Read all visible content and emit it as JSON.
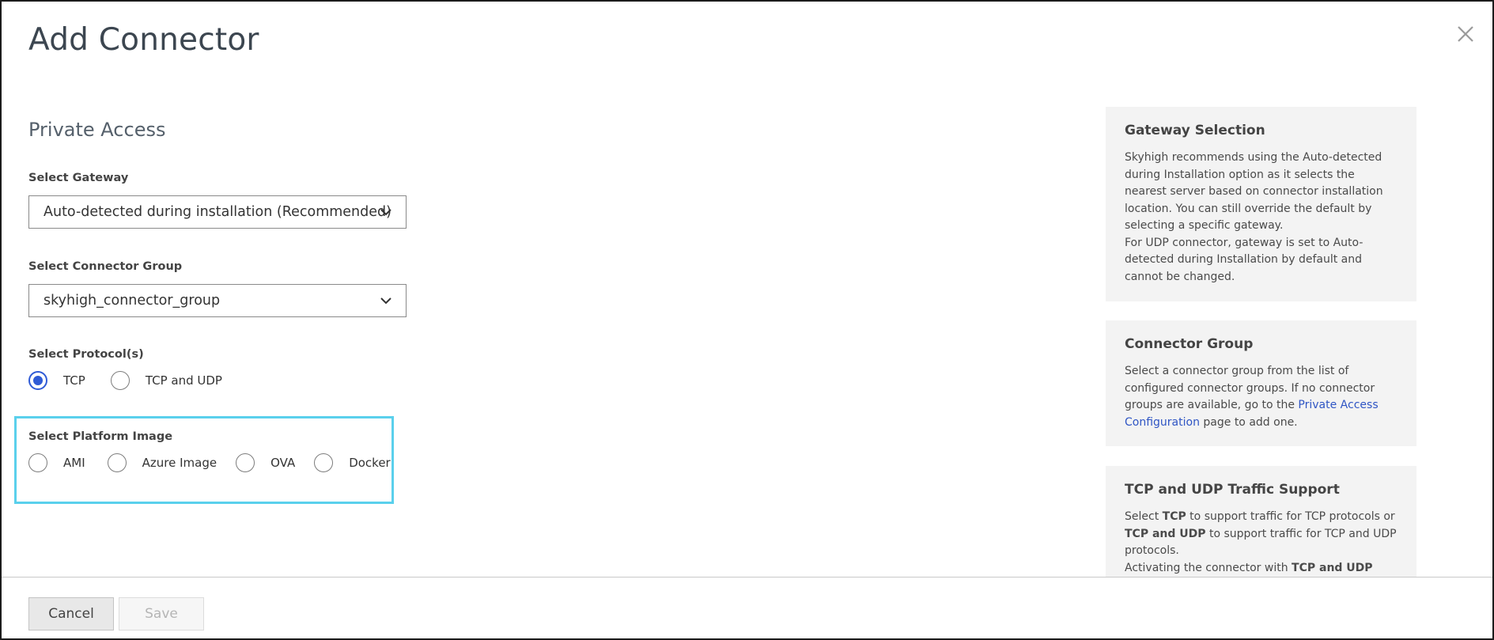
{
  "dialog": {
    "title": "Add Connector",
    "close_icon": "close-icon"
  },
  "form": {
    "section_title": "Private Access",
    "gateway": {
      "label": "Select Gateway",
      "value": "Auto-detected during installation (Recommended)"
    },
    "connector_group": {
      "label": "Select Connector Group",
      "value": "skyhigh_connector_group"
    },
    "protocols": {
      "label": "Select Protocol(s)",
      "options": [
        {
          "label": "TCP",
          "checked": true
        },
        {
          "label": "TCP and UDP",
          "checked": false
        }
      ]
    },
    "platform_image": {
      "label": "Select Platform Image",
      "options": [
        {
          "label": "AMI",
          "checked": false
        },
        {
          "label": "Azure Image",
          "checked": false
        },
        {
          "label": "OVA",
          "checked": false
        },
        {
          "label": "Docker",
          "checked": false
        }
      ]
    }
  },
  "info": {
    "gateway_selection": {
      "title": "Gateway Selection",
      "lines": [
        "Skyhigh recommends using the Auto-detected",
        "during Installation option as it selects the",
        "nearest server based on connector installation",
        "location. You can still override the default by",
        "selecting a specific gateway.",
        "For UDP connector, gateway is set to Auto-",
        "detected during Installation by default and",
        "cannot be changed."
      ]
    },
    "connector_group": {
      "title": "Connector Group",
      "line1": "Select a connector group from the list of",
      "line2": "configured connector groups. If no connector",
      "line3_pre": "groups are available, go to the ",
      "link_part1": "Private Access",
      "link_part2": "Configuration",
      "line4_post": " page to add one."
    },
    "traffic_support": {
      "title": "TCP and UDP Traffic Support",
      "select": "Select ",
      "tcp": "TCP",
      "mid1": " to support traffic for TCP protocols or",
      "tcp_udp": "TCP and UDP",
      "mid2": " to support traffic for TCP and UDP",
      "protocols": "protocols.",
      "activating": "Activating the connector with ",
      "tcp_udp2": "TCP and UDP"
    }
  },
  "footer": {
    "cancel_label": "Cancel",
    "save_label": "Save"
  },
  "colors": {
    "accent": "#2f5bd6",
    "highlight_border": "#5ad0ec",
    "link": "#2f55c4",
    "panel_bg": "#f3f3f3"
  }
}
